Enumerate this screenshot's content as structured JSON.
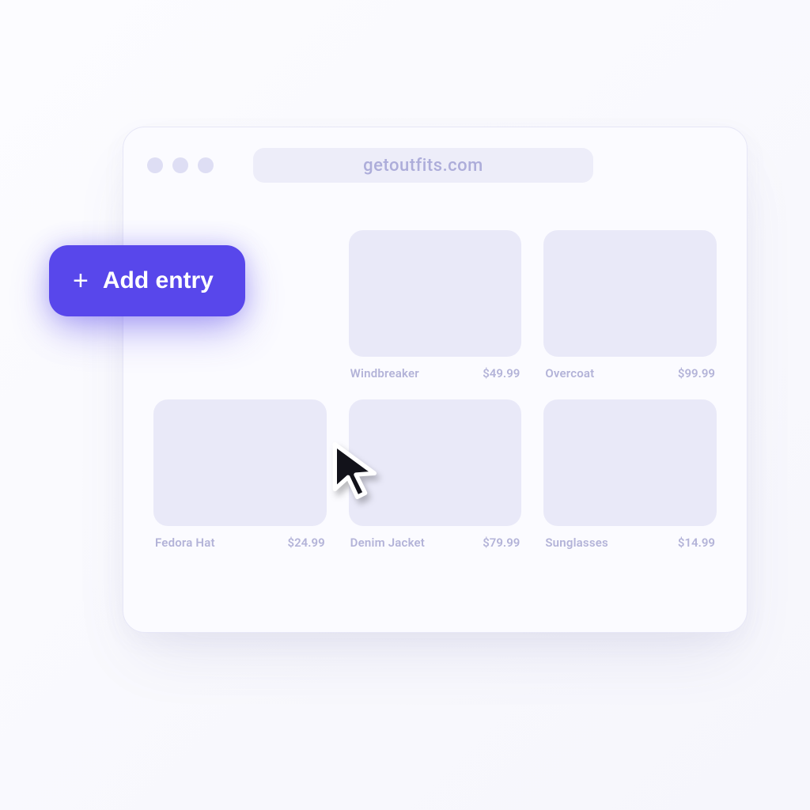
{
  "browser": {
    "url": "getoutfits.com"
  },
  "add_entry": {
    "label": "Add entry"
  },
  "products": [
    {
      "name": "",
      "price": ""
    },
    {
      "name": "Windbreaker",
      "price": "$49.99"
    },
    {
      "name": "Overcoat",
      "price": "$99.99"
    },
    {
      "name": "Fedora Hat",
      "price": "$24.99"
    },
    {
      "name": "Denim Jacket",
      "price": "$79.99"
    },
    {
      "name": "Sunglasses",
      "price": "$14.99"
    }
  ]
}
